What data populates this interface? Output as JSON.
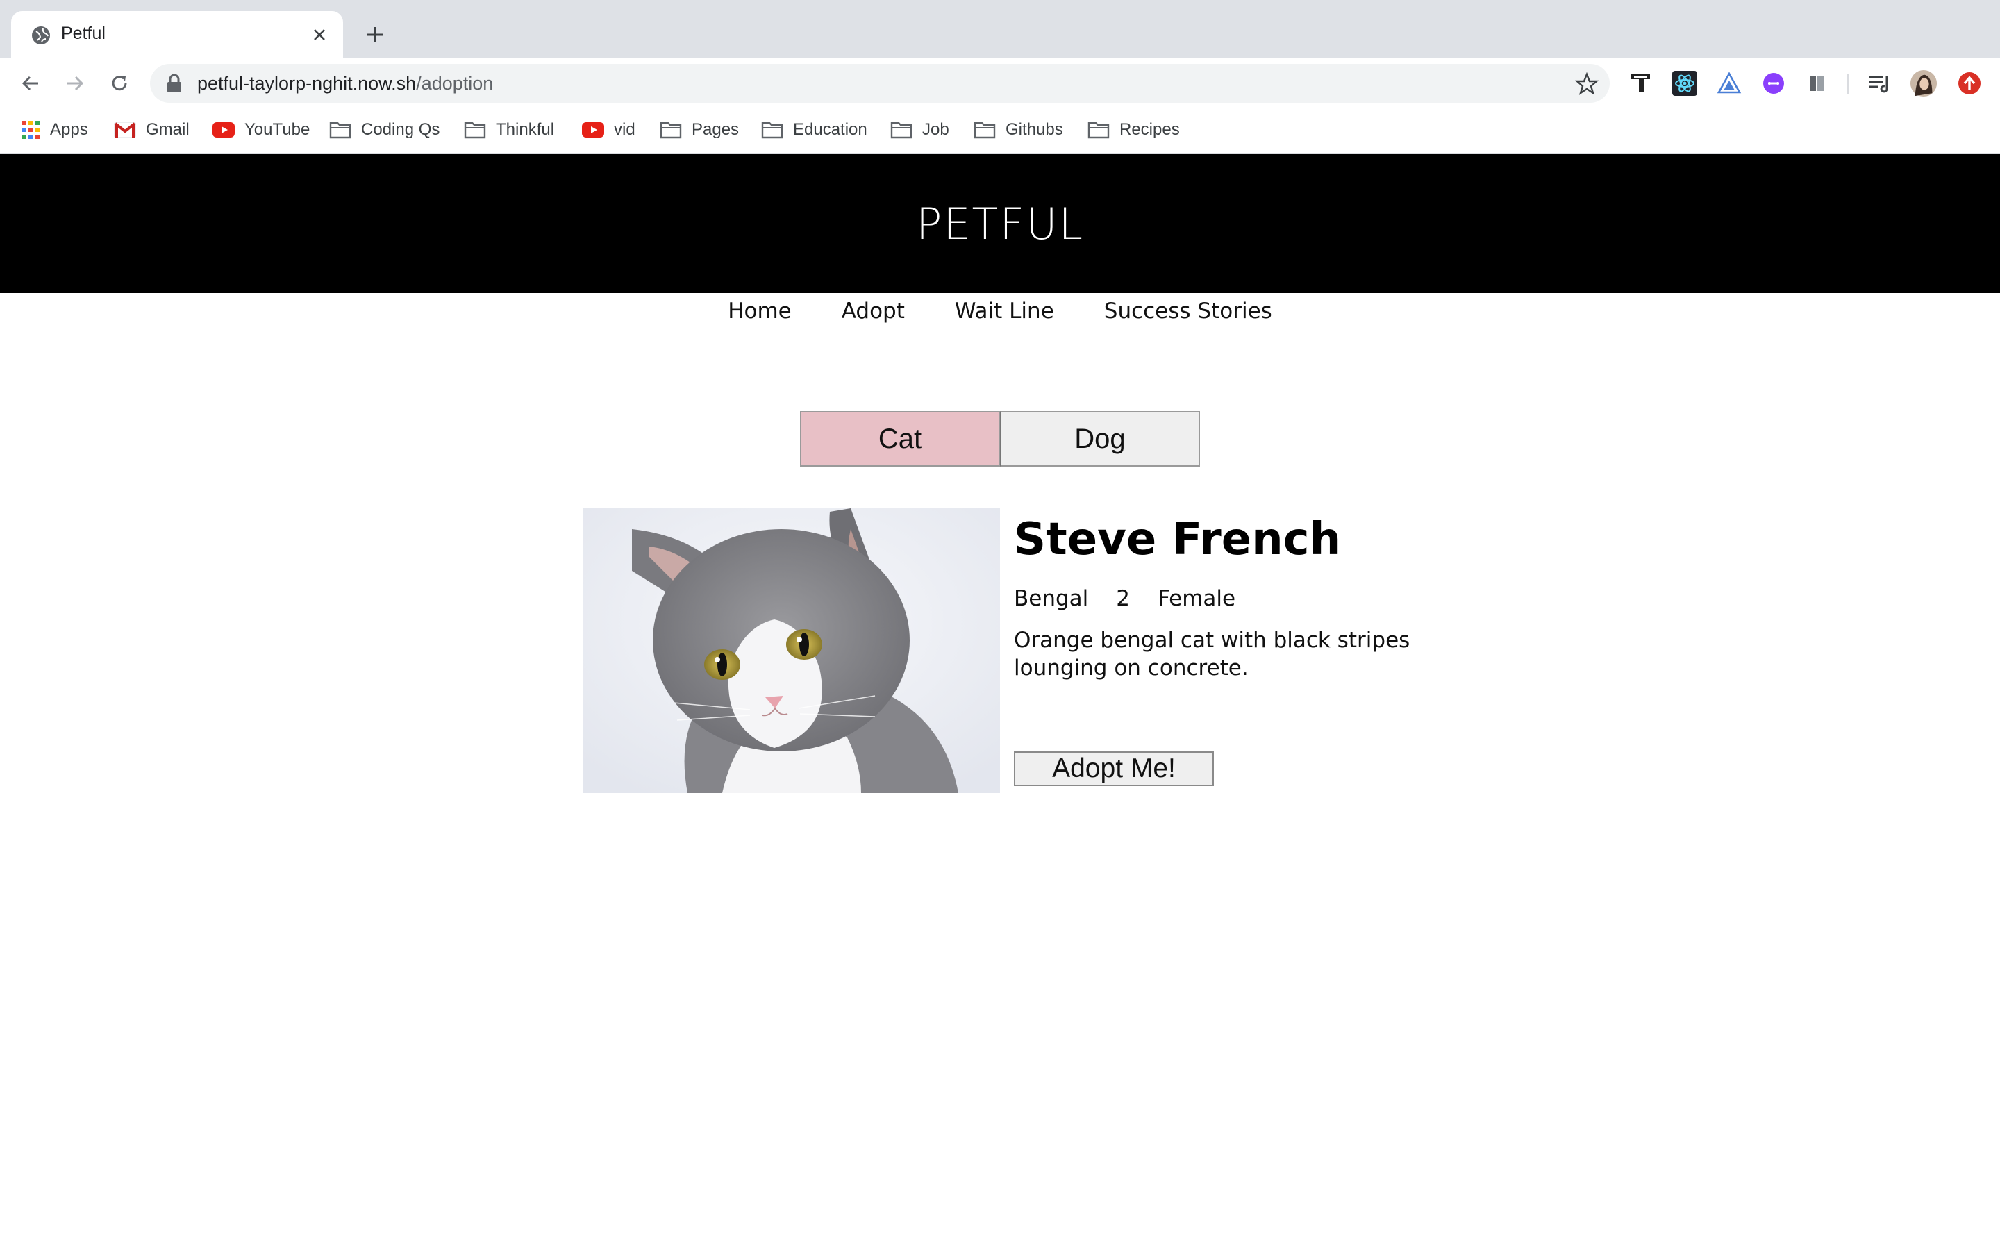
{
  "browser": {
    "tab_title": "Petful",
    "url_host": "petful-taylorp-nghit.now.sh",
    "url_path": "/adoption",
    "bookmarks": [
      {
        "label": "Apps",
        "icon": "apps-grid-icon"
      },
      {
        "label": "Gmail",
        "icon": "gmail-icon"
      },
      {
        "label": "YouTube",
        "icon": "youtube-icon"
      },
      {
        "label": "Coding Qs",
        "icon": "folder-icon"
      },
      {
        "label": "Thinkful",
        "icon": "folder-icon"
      },
      {
        "label": "vid",
        "icon": "youtube-icon"
      },
      {
        "label": "Pages",
        "icon": "folder-icon"
      },
      {
        "label": "Education",
        "icon": "folder-icon"
      },
      {
        "label": "Job",
        "icon": "folder-icon"
      },
      {
        "label": "Githubs",
        "icon": "folder-icon"
      },
      {
        "label": "Recipes",
        "icon": "folder-icon"
      }
    ],
    "extensions": [
      "typora-icon",
      "react-devtools-icon",
      "triangle-extension-icon",
      "purple-extension-icon",
      "bookmark-extension-icon",
      "reading-list-icon",
      "profile-avatar",
      "update-icon"
    ]
  },
  "site": {
    "title": "PETFUL",
    "nav": [
      "Home",
      "Adopt",
      "Wait Line",
      "Success Stories"
    ]
  },
  "toggle": {
    "cat": "Cat",
    "dog": "Dog",
    "active": "Cat",
    "active_color": "#e8c0c6"
  },
  "pet": {
    "name": "Steve French",
    "breed": "Bengal",
    "age": "2",
    "sex": "Female",
    "description": "Orange bengal cat with black stripes lounging on concrete.",
    "adopt_label": "Adopt Me!"
  }
}
